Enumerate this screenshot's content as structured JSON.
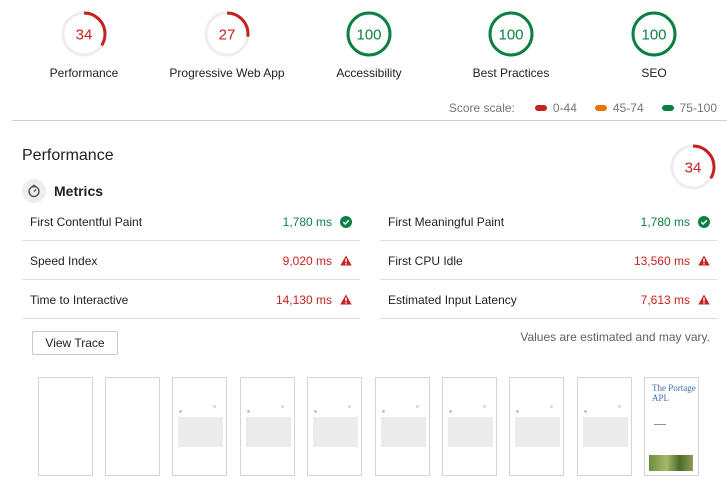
{
  "gauges": [
    {
      "score": 34,
      "label": "Performance",
      "color": "#c5221f"
    },
    {
      "score": 27,
      "label": "Progressive Web App",
      "color": "#c5221f"
    },
    {
      "score": 100,
      "label": "Accessibility",
      "color": "#0b8043"
    },
    {
      "score": 100,
      "label": "Best Practices",
      "color": "#0b8043"
    },
    {
      "score": 100,
      "label": "SEO",
      "color": "#0b8043"
    }
  ],
  "score_scale": {
    "label": "Score scale:",
    "ranges": [
      {
        "label": "0-44",
        "color": "#c5221f"
      },
      {
        "label": "45-74",
        "color": "#e67700"
      },
      {
        "label": "75-100",
        "color": "#0b8043"
      }
    ]
  },
  "performance": {
    "title": "Performance",
    "score": 34,
    "metrics_title": "Metrics",
    "metrics_left": [
      {
        "label": "First Contentful Paint",
        "value": "1,780 ms",
        "status": "pass"
      },
      {
        "label": "Speed Index",
        "value": "9,020 ms",
        "status": "fail"
      },
      {
        "label": "Time to Interactive",
        "value": "14,130 ms",
        "status": "fail"
      }
    ],
    "metrics_right": [
      {
        "label": "First Meaningful Paint",
        "value": "1,780 ms",
        "status": "pass"
      },
      {
        "label": "First CPU Idle",
        "value": "13,560 ms",
        "status": "fail"
      },
      {
        "label": "Estimated Input Latency",
        "value": "7,613 ms",
        "status": "fail"
      }
    ],
    "view_trace_label": "View Trace",
    "note": "Values are estimated and may vary."
  },
  "filmstrip": {
    "last_frame_title": "The Portage APL"
  }
}
